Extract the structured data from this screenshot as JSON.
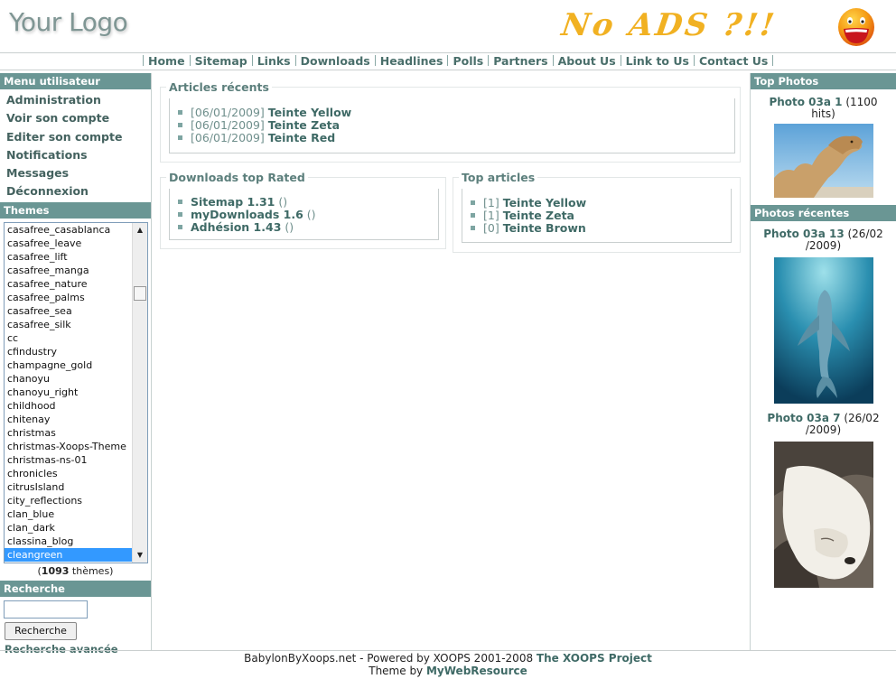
{
  "header": {
    "logo_text": "Your Logo",
    "ad_text": "No ADS ?!!"
  },
  "nav": {
    "items": [
      "Home",
      "Sitemap",
      "Links",
      "Downloads",
      "Headlines",
      "Polls",
      "Partners",
      "About Us",
      "Link to Us",
      "Contact Us"
    ]
  },
  "user_menu": {
    "title": "Menu utilisateur",
    "items": [
      "Administration",
      "Voir son compte",
      "Editer son compte",
      "Notifications",
      "Messages",
      "Déconnexion"
    ]
  },
  "themes": {
    "title": "Themes",
    "options": [
      "casafree_casablanca",
      "casafree_leave",
      "casafree_lift",
      "casafree_manga",
      "casafree_nature",
      "casafree_palms",
      "casafree_sea",
      "casafree_silk",
      "cc",
      "cfindustry",
      "champagne_gold",
      "chanoyu",
      "chanoyu_right",
      "childhood",
      "chitenay",
      "christmas",
      "christmas-Xoops-Theme",
      "christmas-ns-01",
      "chronicles",
      "citrusIsland",
      "city_reflections",
      "clan_blue",
      "clan_dark",
      "classina_blog",
      "cleangreen"
    ],
    "selected": "cleangreen",
    "count_open": "(",
    "count": "1093",
    "count_close": " thèmes)"
  },
  "search": {
    "title": "Recherche",
    "input_value": "",
    "button_label": "Recherche",
    "advanced_label": "Recherche avancée"
  },
  "recent_articles": {
    "title": "Articles récents",
    "items": [
      {
        "date": "[06/01/2009]",
        "title": "Teinte Yellow"
      },
      {
        "date": "[06/01/2009]",
        "title": "Teinte Zeta"
      },
      {
        "date": "[06/01/2009]",
        "title": "Teinte Red"
      }
    ]
  },
  "downloads": {
    "title": "Downloads top Rated",
    "items": [
      {
        "name": "Sitemap 1.31",
        "suffix": " ()"
      },
      {
        "name": "myDownloads 1.6",
        "suffix": " ()"
      },
      {
        "name": "Adhésion 1.43",
        "suffix": " ()"
      }
    ]
  },
  "top_articles": {
    "title": "Top articles",
    "items": [
      {
        "count": "[1]",
        "title": "Teinte Yellow"
      },
      {
        "count": "[1]",
        "title": "Teinte Zeta"
      },
      {
        "count": "[0]",
        "title": "Teinte Brown"
      }
    ]
  },
  "top_photos": {
    "title": "Top Photos",
    "photo": {
      "title": "Photo 03a 1",
      "info": " (1100 hits)"
    }
  },
  "recent_photos": {
    "title": "Photos récentes",
    "photos": [
      {
        "title": "Photo 03a 13",
        "info": " (26/02 /2009)"
      },
      {
        "title": "Photo 03a 7",
        "info": " (26/02 /2009)"
      }
    ]
  },
  "footer": {
    "line1_text": "BabylonByXoops.net - Powered by XOOPS 2001-2008 ",
    "line1_link": "The XOOPS Project",
    "line2_text": "Theme by ",
    "line2_link": "MyWebResource"
  },
  "colors": {
    "block_title_bg": "#6a9694",
    "link": "#3f6a66",
    "selected_option": "#3399ff"
  }
}
